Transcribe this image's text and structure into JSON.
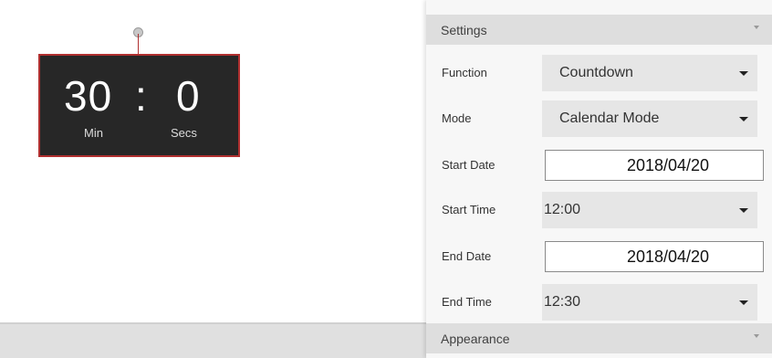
{
  "timer": {
    "minutes": "30",
    "separator": ":",
    "seconds": "0",
    "min_label": "Min",
    "sec_label": "Secs"
  },
  "panel": {
    "settings_title": "Settings",
    "appearance_title": "Appearance",
    "rows": {
      "function": {
        "label": "Function",
        "value": "Countdown"
      },
      "mode": {
        "label": "Mode",
        "value": "Calendar Mode"
      },
      "start_date": {
        "label": "Start Date",
        "value": "2018/04/20"
      },
      "start_time": {
        "label": "Start Time",
        "value": "12:00"
      },
      "end_date": {
        "label": "End Date",
        "value": "2018/04/20"
      },
      "end_time": {
        "label": "End Time",
        "value": "12:30"
      }
    }
  },
  "colors": {
    "timer_background": "#272727",
    "selection_border": "#b03030",
    "header_background": "#dedede",
    "select_background": "#e6e6e6"
  },
  "icons": {
    "collapse": "chevron-down-icon",
    "dropdown": "caret-down-icon",
    "handle": "rotation-handle-icon"
  }
}
